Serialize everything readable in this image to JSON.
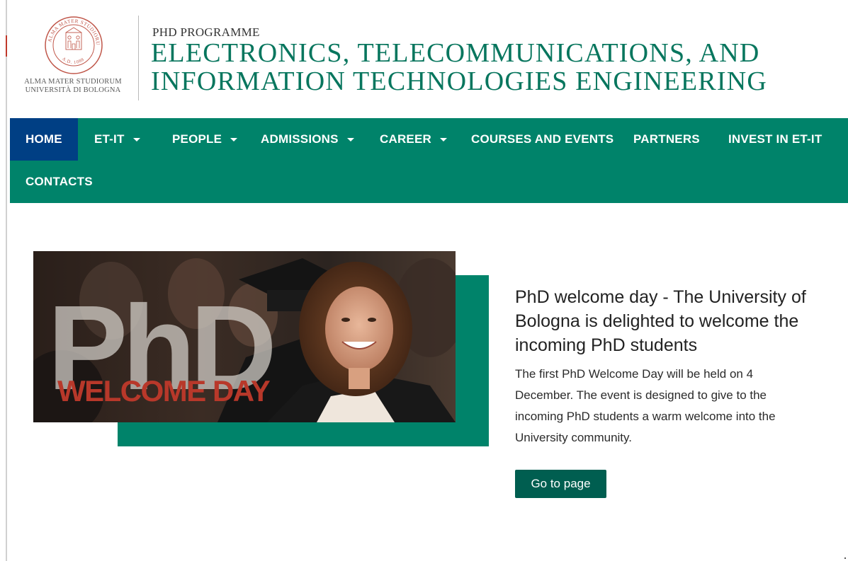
{
  "header": {
    "logo": {
      "seal_text": "ALMA MATER STUDIORUM · A.D. 1088",
      "line1": "ALMA MATER STUDIORUM",
      "line2": "UNIVERSITÀ DI BOLOGNA",
      "seal_color": "#c0574a"
    },
    "programme_label": "PHD PROGRAMME",
    "title_line1": "ELECTRONICS, TELECOMMUNICATIONS, AND",
    "title_line2": "INFORMATION TECHNOLOGIES ENGINEERING"
  },
  "nav": {
    "items": [
      {
        "label": "HOME",
        "active": true,
        "dropdown": false
      },
      {
        "label": "ET-IT",
        "active": false,
        "dropdown": true
      },
      {
        "label": "PEOPLE",
        "active": false,
        "dropdown": true
      },
      {
        "label": "ADMISSIONS",
        "active": false,
        "dropdown": true
      },
      {
        "label": "CAREER",
        "active": false,
        "dropdown": true
      },
      {
        "label": "COURSES AND EVENTS",
        "active": false,
        "dropdown": false
      },
      {
        "label": "PARTNERS",
        "active": false,
        "dropdown": false
      },
      {
        "label": "INVEST IN ET-IT",
        "active": false,
        "dropdown": false
      },
      {
        "label": "CONTACTS",
        "active": false,
        "dropdown": false
      }
    ]
  },
  "hero": {
    "image_text_big": "PhD",
    "image_text_banner": "WELCOME DAY"
  },
  "news": {
    "title": "PhD welcome day - The University of Bologna is delighted to welcome the incoming PhD students",
    "text": "The first PhD Welcome Day will be held on 4 December. The event is designed to give to the incoming PhD students a warm welcome into the University community.",
    "button_label": "Go to page"
  },
  "colors": {
    "brand_green": "#00836a",
    "active_blue": "#003f84",
    "button_green": "#005e50",
    "title_green": "#08765e",
    "banner_red": "#b8382a"
  }
}
